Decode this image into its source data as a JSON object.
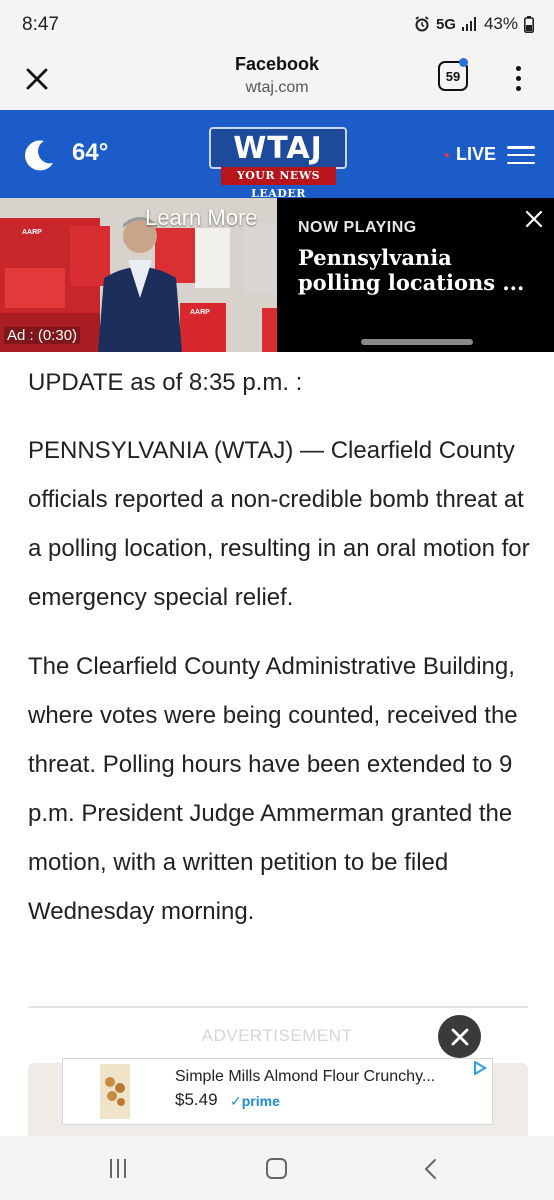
{
  "status_bar": {
    "time": "8:47",
    "network": "5G",
    "battery": "43%",
    "icons": [
      "alarm-icon",
      "signal-icon",
      "battery-icon"
    ]
  },
  "browser": {
    "source": "Facebook",
    "url": "wtaj.com",
    "tab_count": "59"
  },
  "site_header": {
    "temperature": "64°",
    "logo_text": "WTAJ",
    "logo_tagline": "YOUR NEWS LEADER",
    "live_label": "LIVE",
    "colors": {
      "header_bg": "#1b5cc8",
      "tagline_bg": "#b8141b"
    }
  },
  "video_strip": {
    "ad_cta": "Learn More",
    "ad_timer": "Ad : (0:30)",
    "ad_brand": "AARP",
    "now_playing_label": "NOW PLAYING",
    "now_playing_title": "Pennsylvania polling locations ..."
  },
  "article": {
    "update_line": "UPDATE as of 8:35 p.m. :",
    "paragraph_1": "PENNSYLVANIA (WTAJ) — Clearfield County officials reported a non-credible bomb threat at a polling location, resulting in an oral motion for emergency special relief.",
    "paragraph_2": "The Clearfield County Administrative Building, where votes were being counted, received the threat. Polling hours have been extended to 9 p.m. President Judge Ammerman granted the motion, with a written petition to be filed Wednesday morning."
  },
  "advertisement": {
    "label": "ADVERTISEMENT",
    "product_name": "Simple Mills Almond Flour Crunchy...",
    "price": "$5.49",
    "prime": "✓prime"
  }
}
